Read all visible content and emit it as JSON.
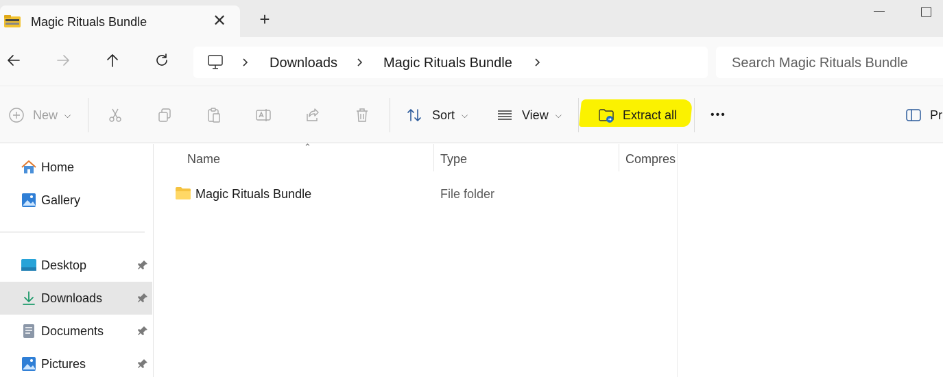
{
  "tab": {
    "title": "Magic Rituals Bundle",
    "close_glyph": "✕",
    "new_tab_glyph": "+"
  },
  "breadcrumb": {
    "items": [
      "Downloads",
      "Magic Rituals Bundle"
    ]
  },
  "search": {
    "placeholder": "Search Magic Rituals Bundle"
  },
  "toolbar": {
    "new_label": "New",
    "sort_label": "Sort",
    "view_label": "View",
    "extract_label": "Extract all",
    "more_glyph": "•••",
    "preview_label": "Pr",
    "highlight_color": "#fbf200"
  },
  "sidebar": {
    "quick": [
      {
        "label": "Home",
        "icon": "home-icon"
      },
      {
        "label": "Gallery",
        "icon": "gallery-icon"
      }
    ],
    "pinned": [
      {
        "label": "Desktop",
        "icon": "desktop-icon"
      },
      {
        "label": "Downloads",
        "icon": "downloads-icon",
        "selected": true
      },
      {
        "label": "Documents",
        "icon": "documents-icon"
      },
      {
        "label": "Pictures",
        "icon": "pictures-icon"
      }
    ]
  },
  "columns": {
    "name": "Name",
    "type": "Type",
    "compressed": "Compres"
  },
  "files": [
    {
      "name": "Magic Rituals Bundle",
      "type": "File folder",
      "icon": "folder-icon"
    }
  ]
}
